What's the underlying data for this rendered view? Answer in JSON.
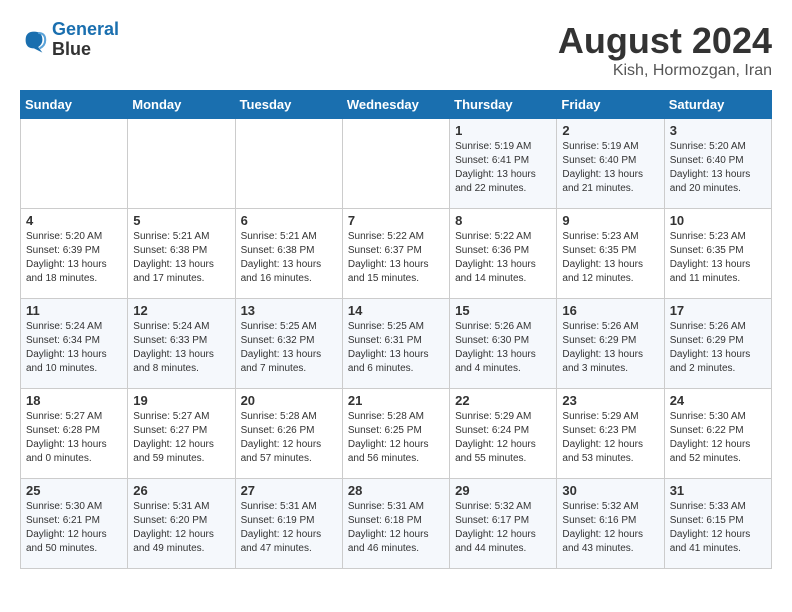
{
  "header": {
    "logo_line1": "General",
    "logo_line2": "Blue",
    "title": "August 2024",
    "subtitle": "Kish, Hormozgan, Iran"
  },
  "weekdays": [
    "Sunday",
    "Monday",
    "Tuesday",
    "Wednesday",
    "Thursday",
    "Friday",
    "Saturday"
  ],
  "weeks": [
    [
      {
        "day": "",
        "info": ""
      },
      {
        "day": "",
        "info": ""
      },
      {
        "day": "",
        "info": ""
      },
      {
        "day": "",
        "info": ""
      },
      {
        "day": "1",
        "info": "Sunrise: 5:19 AM\nSunset: 6:41 PM\nDaylight: 13 hours\nand 22 minutes."
      },
      {
        "day": "2",
        "info": "Sunrise: 5:19 AM\nSunset: 6:40 PM\nDaylight: 13 hours\nand 21 minutes."
      },
      {
        "day": "3",
        "info": "Sunrise: 5:20 AM\nSunset: 6:40 PM\nDaylight: 13 hours\nand 20 minutes."
      }
    ],
    [
      {
        "day": "4",
        "info": "Sunrise: 5:20 AM\nSunset: 6:39 PM\nDaylight: 13 hours\nand 18 minutes."
      },
      {
        "day": "5",
        "info": "Sunrise: 5:21 AM\nSunset: 6:38 PM\nDaylight: 13 hours\nand 17 minutes."
      },
      {
        "day": "6",
        "info": "Sunrise: 5:21 AM\nSunset: 6:38 PM\nDaylight: 13 hours\nand 16 minutes."
      },
      {
        "day": "7",
        "info": "Sunrise: 5:22 AM\nSunset: 6:37 PM\nDaylight: 13 hours\nand 15 minutes."
      },
      {
        "day": "8",
        "info": "Sunrise: 5:22 AM\nSunset: 6:36 PM\nDaylight: 13 hours\nand 14 minutes."
      },
      {
        "day": "9",
        "info": "Sunrise: 5:23 AM\nSunset: 6:35 PM\nDaylight: 13 hours\nand 12 minutes."
      },
      {
        "day": "10",
        "info": "Sunrise: 5:23 AM\nSunset: 6:35 PM\nDaylight: 13 hours\nand 11 minutes."
      }
    ],
    [
      {
        "day": "11",
        "info": "Sunrise: 5:24 AM\nSunset: 6:34 PM\nDaylight: 13 hours\nand 10 minutes."
      },
      {
        "day": "12",
        "info": "Sunrise: 5:24 AM\nSunset: 6:33 PM\nDaylight: 13 hours\nand 8 minutes."
      },
      {
        "day": "13",
        "info": "Sunrise: 5:25 AM\nSunset: 6:32 PM\nDaylight: 13 hours\nand 7 minutes."
      },
      {
        "day": "14",
        "info": "Sunrise: 5:25 AM\nSunset: 6:31 PM\nDaylight: 13 hours\nand 6 minutes."
      },
      {
        "day": "15",
        "info": "Sunrise: 5:26 AM\nSunset: 6:30 PM\nDaylight: 13 hours\nand 4 minutes."
      },
      {
        "day": "16",
        "info": "Sunrise: 5:26 AM\nSunset: 6:29 PM\nDaylight: 13 hours\nand 3 minutes."
      },
      {
        "day": "17",
        "info": "Sunrise: 5:26 AM\nSunset: 6:29 PM\nDaylight: 13 hours\nand 2 minutes."
      }
    ],
    [
      {
        "day": "18",
        "info": "Sunrise: 5:27 AM\nSunset: 6:28 PM\nDaylight: 13 hours\nand 0 minutes."
      },
      {
        "day": "19",
        "info": "Sunrise: 5:27 AM\nSunset: 6:27 PM\nDaylight: 12 hours\nand 59 minutes."
      },
      {
        "day": "20",
        "info": "Sunrise: 5:28 AM\nSunset: 6:26 PM\nDaylight: 12 hours\nand 57 minutes."
      },
      {
        "day": "21",
        "info": "Sunrise: 5:28 AM\nSunset: 6:25 PM\nDaylight: 12 hours\nand 56 minutes."
      },
      {
        "day": "22",
        "info": "Sunrise: 5:29 AM\nSunset: 6:24 PM\nDaylight: 12 hours\nand 55 minutes."
      },
      {
        "day": "23",
        "info": "Sunrise: 5:29 AM\nSunset: 6:23 PM\nDaylight: 12 hours\nand 53 minutes."
      },
      {
        "day": "24",
        "info": "Sunrise: 5:30 AM\nSunset: 6:22 PM\nDaylight: 12 hours\nand 52 minutes."
      }
    ],
    [
      {
        "day": "25",
        "info": "Sunrise: 5:30 AM\nSunset: 6:21 PM\nDaylight: 12 hours\nand 50 minutes."
      },
      {
        "day": "26",
        "info": "Sunrise: 5:31 AM\nSunset: 6:20 PM\nDaylight: 12 hours\nand 49 minutes."
      },
      {
        "day": "27",
        "info": "Sunrise: 5:31 AM\nSunset: 6:19 PM\nDaylight: 12 hours\nand 47 minutes."
      },
      {
        "day": "28",
        "info": "Sunrise: 5:31 AM\nSunset: 6:18 PM\nDaylight: 12 hours\nand 46 minutes."
      },
      {
        "day": "29",
        "info": "Sunrise: 5:32 AM\nSunset: 6:17 PM\nDaylight: 12 hours\nand 44 minutes."
      },
      {
        "day": "30",
        "info": "Sunrise: 5:32 AM\nSunset: 6:16 PM\nDaylight: 12 hours\nand 43 minutes."
      },
      {
        "day": "31",
        "info": "Sunrise: 5:33 AM\nSunset: 6:15 PM\nDaylight: 12 hours\nand 41 minutes."
      }
    ]
  ]
}
